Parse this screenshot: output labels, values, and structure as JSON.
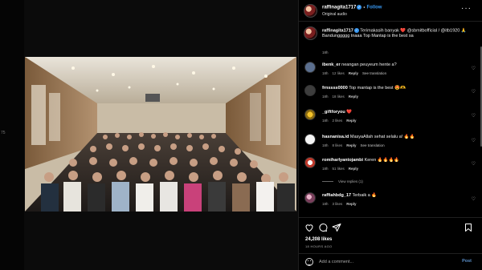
{
  "side_marker": "75",
  "post": {
    "username": "raffinagita1717",
    "separator": "•",
    "follow_label": "Follow",
    "audio": "Original audio",
    "more_label": "···"
  },
  "caption": {
    "username": "raffinagita1717",
    "text": "Terimakasih banyak ❤️ @sbmitbofficial / @itb1920 🙏 Bandunggggg tnaaa Top Mantap is the best sa",
    "time": "18h"
  },
  "comments": [
    {
      "username": "ibenk_er",
      "text": "neangan peuyeum hente a?",
      "time": "18h",
      "likes": "12 likes",
      "reply": "Reply",
      "translation": "See translation"
    },
    {
      "username": "frnssss0000",
      "text": "Top mantap is the best 😍🫶",
      "time": "18h",
      "likes": "18 likes",
      "reply": "Reply",
      "translation": ""
    },
    {
      "username": "_giftforyou",
      "text": "❤️",
      "time": "18h",
      "likes": "2 likes",
      "reply": "Reply",
      "translation": ""
    },
    {
      "username": "hasnanisa.id",
      "text": "MasyaAllah sehat selalu a! 🔥🔥",
      "time": "18h",
      "likes": "8 likes",
      "reply": "Reply",
      "translation": "See translation"
    },
    {
      "username": "romiharlyantojambi",
      "text": "Keren 🔥🔥🔥🔥",
      "time": "18h",
      "likes": "51 likes",
      "reply": "Reply",
      "translation": ""
    },
    {
      "username": "raffiahbdg_17",
      "text": "Terbaik a 🔥",
      "time": "18h",
      "likes": "3 likes",
      "reply": "Reply",
      "translation": ""
    }
  ],
  "view_replies": "View replies (1)",
  "actions": {
    "likes": "24,208 likes",
    "ago": "18 HOURS AGO"
  },
  "add_comment": {
    "placeholder": "Add a comment...",
    "post_label": "Post"
  },
  "icons": {
    "media_user_tag": "person-tag-icon",
    "media_mute": "speaker-muted-icon"
  },
  "colors": {
    "accent": "#3897f0",
    "background": "#000000",
    "muted_text": "#a8a8a8"
  }
}
